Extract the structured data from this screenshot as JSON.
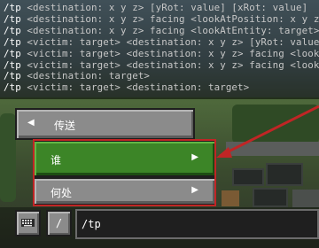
{
  "chat": {
    "lines": [
      {
        "cmd": "/tp",
        "rest": "<destination: x y z> [yRot: value] [xRot: value]"
      },
      {
        "cmd": "/tp",
        "rest": "<destination: x y z> facing <lookAtPosition: x y z>"
      },
      {
        "cmd": "/tp",
        "rest": "<destination: x y z> facing <lookAtEntity: target>"
      },
      {
        "cmd": "/tp",
        "rest": "<victim: target> <destination: x y z> [yRot: value]"
      },
      {
        "cmd": "/tp",
        "rest": "<victim: target> <destination: x y z> facing <lookA"
      },
      {
        "cmd": "/tp",
        "rest": "<victim: target> <destination: x y z> facing <lookA"
      },
      {
        "cmd": "/tp",
        "rest": "<destination: target>"
      },
      {
        "cmd": "/tp",
        "rest": "<victim: target> <destination: target>"
      }
    ]
  },
  "menu": {
    "back_label": "传送",
    "who_label": "谁",
    "where_label": "何处"
  },
  "input": {
    "slash_label": "/",
    "command_value": "/tp"
  },
  "colors": {
    "selected_green": "#3c8527",
    "button_gray": "#8b8b8b",
    "annotation_red": "#c02525"
  },
  "icons": {
    "back": "chevron-left-icon",
    "forward": "chevron-right-icon",
    "keyboard": "keyboard-icon"
  }
}
